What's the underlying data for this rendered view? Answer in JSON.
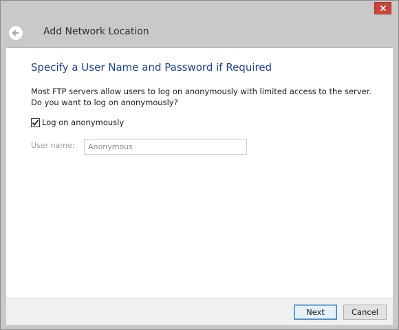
{
  "window": {
    "title": "Add Network Location",
    "close_icon": "close-icon",
    "back_icon": "back-arrow-icon"
  },
  "page": {
    "heading": "Specify a User Name and Password if Required",
    "description": "Most FTP servers allow users to log on anonymously with limited access to the server.  Do you want to log on anonymously?",
    "anonymous_checkbox": {
      "label": "Log on anonymously",
      "checked": true
    },
    "username": {
      "label": "User name:",
      "value": "Anonymous",
      "disabled": true
    }
  },
  "footer": {
    "next_label": "Next",
    "cancel_label": "Cancel"
  },
  "colors": {
    "close_button": "#c7463d",
    "heading": "#1e3f9b",
    "chrome": "#c9c9c9"
  }
}
